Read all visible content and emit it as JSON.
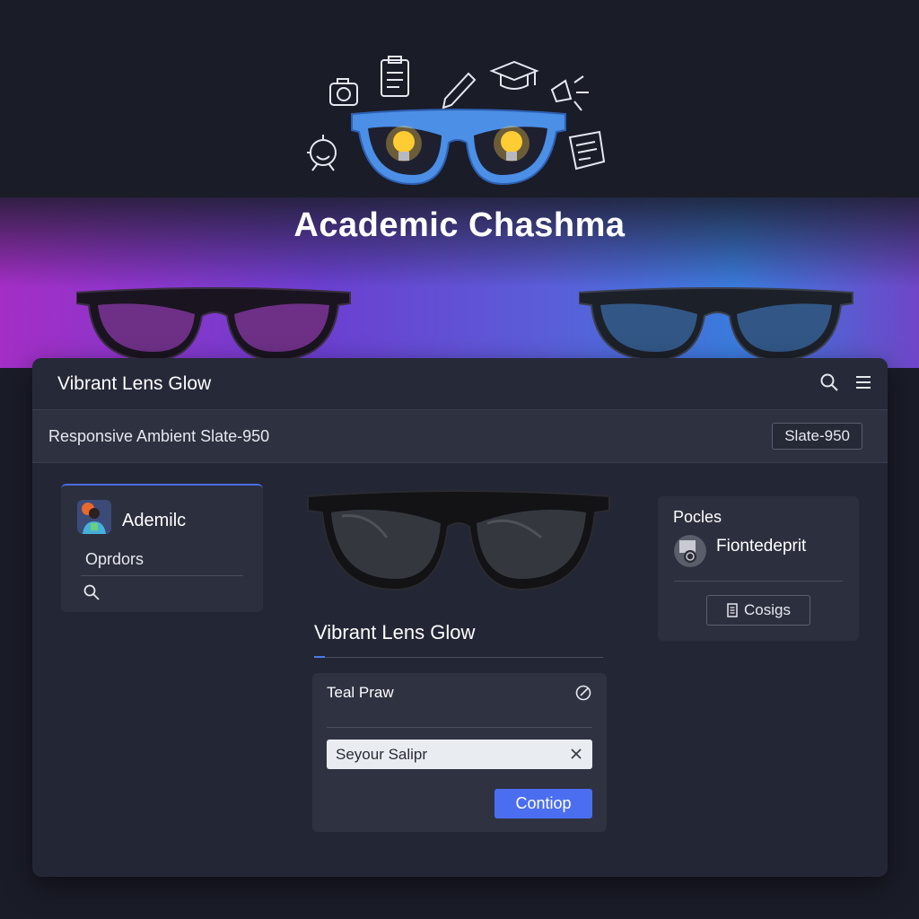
{
  "brand": {
    "title": "Academic Chashma"
  },
  "panel": {
    "title": "Vibrant Lens Glow",
    "icons": [
      "search-icon",
      "menu-icon"
    ]
  },
  "subbar": {
    "text": "Responsive Ambient Slate-950",
    "button_label": "Slate-950"
  },
  "left_card": {
    "name": "Ademilc",
    "subtitle": "Oprdors",
    "icon": "search-icon"
  },
  "center": {
    "title": "Vibrant Lens Glow",
    "form": {
      "label": "Teal Praw",
      "input_value": "Seyour Salipr",
      "button_label": "Contiop"
    }
  },
  "right_card": {
    "title": "Pocles",
    "name": "Fiontedeprit",
    "button_label": "Cosigs"
  },
  "colors": {
    "background": "#1a1c28",
    "panel": "#232634",
    "accent": "#4b6ef0",
    "hero_left": "#a42ec6",
    "hero_right": "#3a7bdc"
  }
}
